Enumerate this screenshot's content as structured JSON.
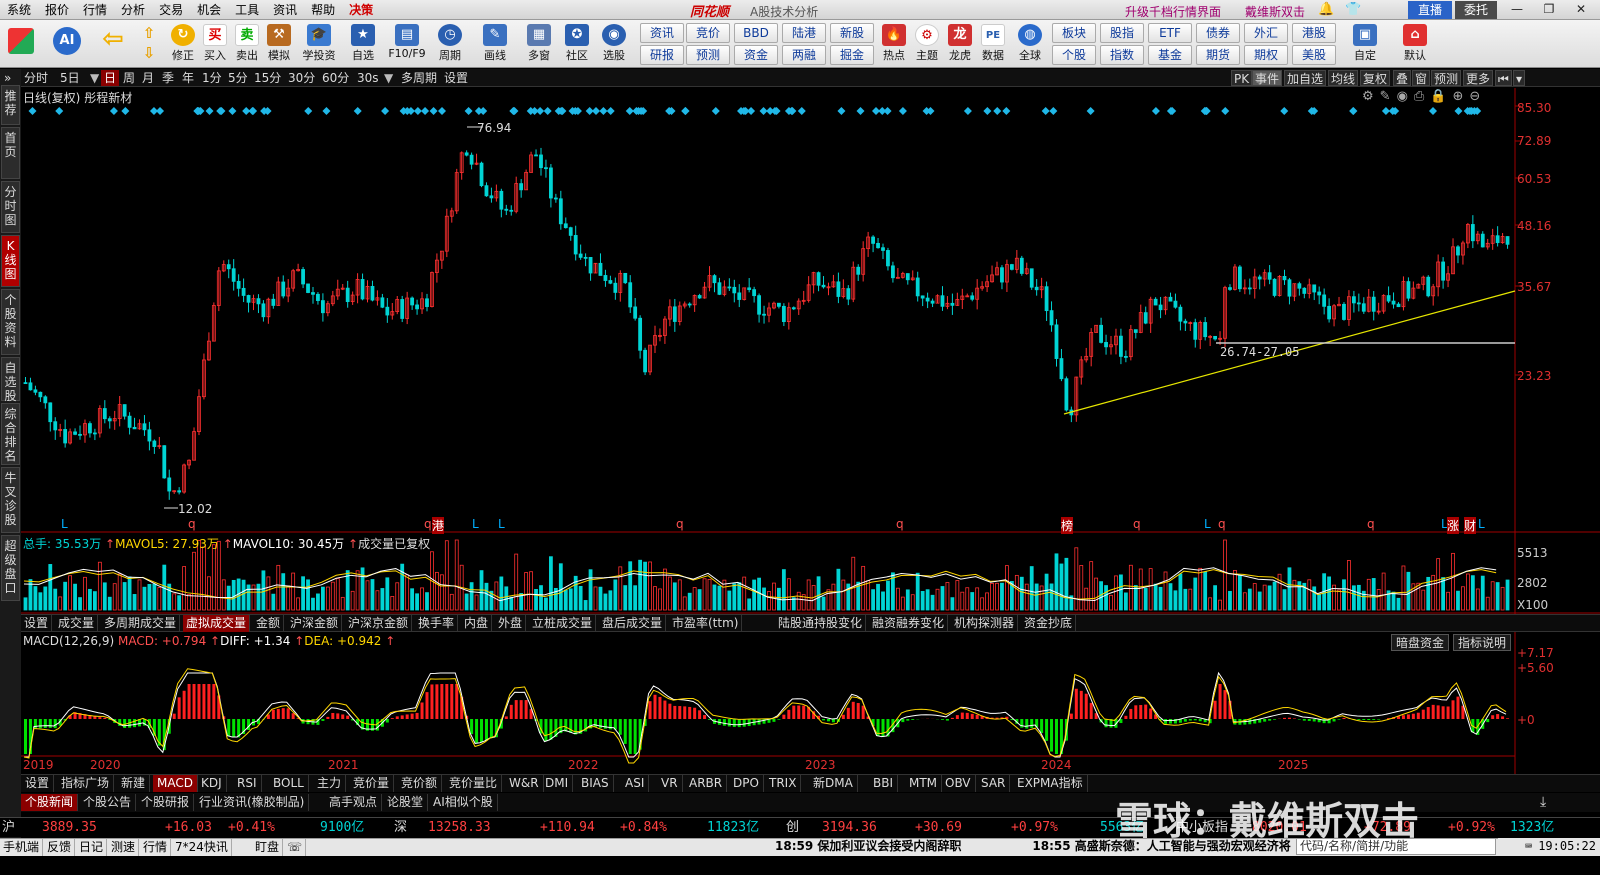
{
  "menu": [
    "系统",
    "报价",
    "行情",
    "分析",
    "交易",
    "机会",
    "工具",
    "资讯",
    "帮助",
    "决策"
  ],
  "app": {
    "title": "同花顺",
    "subtitle": "A股技术分析",
    "promo": "升级千档行情界面",
    "promo2": "戴维斯双击",
    "live": "直播",
    "wt": "委托"
  },
  "toolbar": {
    "btns": [
      "修正",
      "买入",
      "卖出",
      "模拟",
      "学投资",
      "自选",
      "F10/F9",
      "周期",
      "画线",
      "多窗",
      "社区",
      "选股",
      "热点",
      "主题",
      "龙虎",
      "数据",
      "全球",
      "自定",
      "默认"
    ],
    "grid": [
      "资讯",
      "竞价",
      "BBD",
      "陆港",
      "新股",
      "研报",
      "预测",
      "资金",
      "两融",
      "掘金",
      "板块",
      "股指",
      "ETF",
      "债券",
      "外汇",
      "港股",
      "个股",
      "指数",
      "基金",
      "期货",
      "期权",
      "美股"
    ]
  },
  "left_tabs": [
    "推荐",
    "首页",
    "分时图",
    "K线图",
    "个股资料",
    "自选股",
    "综合排名",
    "牛叉诊股",
    "超级盘口"
  ],
  "period": [
    "分时",
    "5日",
    "日",
    "周",
    "月",
    "季",
    "年",
    "1分",
    "5分",
    "15分",
    "30分",
    "60分",
    "30s",
    "多周期",
    "设置"
  ],
  "right_tools": [
    "PK",
    "事件",
    "加自选",
    "均线",
    "复权",
    "叠",
    "窗",
    "预测",
    "更多"
  ],
  "chart": {
    "title": "日线(复权)",
    "stock": "彤程新材",
    "y_labels": [
      "85.30",
      "72.89",
      "60.53",
      "48.16",
      "35.67",
      "23.23"
    ],
    "high_label": "76.94",
    "low_label": "12.02",
    "range_label": "26.74-27.05",
    "markers": [
      "L",
      "q",
      "q",
      "港",
      "L",
      "L",
      "q",
      "q",
      "榜",
      "q",
      "L",
      "q",
      "q",
      "L",
      "涨",
      "财",
      "L"
    ]
  },
  "volume": {
    "header_total": "总手: 35.53万",
    "mavol5": "MAVOL5: 27.93万",
    "mavol10": "MAVOL10: 30.45万",
    "note": "成交量已复权",
    "y_labels": [
      "5513",
      "2802",
      "X100"
    ]
  },
  "indicator_tabs": [
    "设置",
    "成交量",
    "多周期成交量",
    "虚拟成交量",
    "金额",
    "沪深金额",
    "沪深京金额",
    "换手率",
    "内盘",
    "外盘",
    "立桩成交量",
    "盘后成交量",
    "市盈率(ttm)",
    "陆股通持股变化",
    "融资融券变化",
    "机构探测器",
    "资金抄底"
  ],
  "macd": {
    "name": "MACD(12,26,9)",
    "macd": "MACD: +0.794",
    "diff": "DIFF: +1.34",
    "dea": "DEA: +0.942",
    "btn1": "暗盘资金",
    "btn2": "指标说明",
    "y_labels": [
      "+7.17",
      "+5.60",
      "+0"
    ]
  },
  "years": [
    "2019",
    "2020",
    "2021",
    "2022",
    "2023",
    "2024",
    "2025"
  ],
  "main_tabs": [
    "设置",
    "指标广场",
    "新建",
    "MACD",
    "KDJ",
    "RSI",
    "BOLL",
    "主力",
    "竞价量",
    "竞价额",
    "竞价量比",
    "W&R",
    "DMI",
    "BIAS",
    "ASI",
    "VR",
    "ARBR",
    "DPO",
    "TRIX",
    "新DMA",
    "BBI",
    "MTM",
    "OBV",
    "SAR",
    "EXPMA指标"
  ],
  "news_tabs": [
    "个股新闻",
    "个股公告",
    "个股研报",
    "行业资讯(橡胶制品)",
    "高手观点",
    "论股堂",
    "AI相似个股"
  ],
  "indices": [
    {
      "name": "沪",
      "price": "3889.35",
      "chg": "+16.03",
      "pct": "+0.41%",
      "amt": "9100亿"
    },
    {
      "name": "深",
      "price": "13258.33",
      "chg": "+110.94",
      "pct": "+0.84%",
      "amt": "11823亿"
    },
    {
      "name": "创",
      "price": "3194.36",
      "chg": "+30.69",
      "pct": "+0.97%",
      "amt": "5563亿"
    },
    {
      "name": "中小板指",
      "price": "8020.01",
      "chg": "+72.89",
      "pct": "+0.92%",
      "amt": "1323亿"
    }
  ],
  "status": {
    "items": [
      "手机端",
      "反馈",
      "日记",
      "测速",
      "行情",
      "7*24快讯",
      "盯盘"
    ],
    "news1": "18:59 保加利亚议会接受内阁辞职",
    "news2": "18:55 高盛斯奈德：人工智能与强劲宏观经济将",
    "search": "代码/名称/简拼/功能",
    "time": "19:05:22"
  },
  "watermark": "雪球：戴维斯双击",
  "colors": {
    "up": "#ff3030",
    "down": "#00d4d4",
    "macd_up": "#ff2020",
    "macd_down": "#00e000",
    "diff": "#ffffff",
    "dea": "#ffd700",
    "trendline": "#e6e600"
  }
}
